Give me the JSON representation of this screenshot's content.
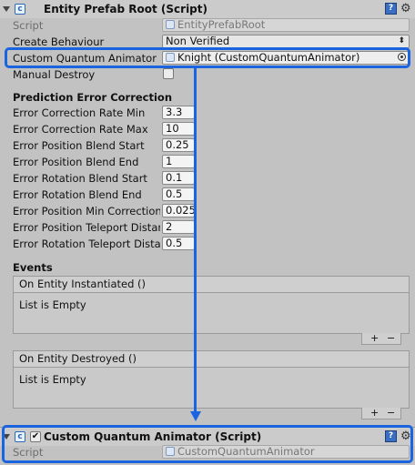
{
  "component1": {
    "title": "Entity Prefab Root (Script)",
    "script_label": "Script",
    "script_value": "EntityPrefabRoot",
    "create_behaviour_label": "Create Behaviour",
    "create_behaviour_value": "Non Verified",
    "custom_animator_label": "Custom Quantum Animator",
    "custom_animator_value": "Knight (CustomQuantumAnimator)",
    "manual_destroy_label": "Manual Destroy"
  },
  "prediction": {
    "header": "Prediction Error Correction",
    "fields": [
      {
        "label": "Error Correction Rate Min",
        "value": "3.3"
      },
      {
        "label": "Error Correction Rate Max",
        "value": "10"
      },
      {
        "label": "Error Position Blend Start",
        "value": "0.25"
      },
      {
        "label": "Error Position Blend End",
        "value": "1"
      },
      {
        "label": "Error Rotation Blend Start",
        "value": "0.1"
      },
      {
        "label": "Error Rotation Blend End",
        "value": "0.5"
      },
      {
        "label": "Error Position Min Correction",
        "value": "0.025"
      },
      {
        "label": "Error Position Teleport Distance",
        "value": "2"
      },
      {
        "label": "Error Rotation Teleport Distance",
        "value": "0.5"
      }
    ]
  },
  "events": {
    "header": "Events",
    "instantiated_title": "On Entity Instantiated ()",
    "instantiated_body": "List is Empty",
    "destroyed_title": "On Entity Destroyed ()",
    "destroyed_body": "List is Empty",
    "plus": "+",
    "minus": "−"
  },
  "component2": {
    "title": "Custom Quantum Animator (Script)",
    "script_label": "Script",
    "script_value": "CustomQuantumAnimator"
  },
  "colors": {
    "highlight": "#1b64e0",
    "background": "#c2c2c2"
  },
  "icons": {
    "component": "c-sharp-script-icon",
    "help": "book-help-icon",
    "settings": "gear-icon",
    "fold": "foldout-arrow-icon",
    "picker": "object-picker-icon"
  }
}
